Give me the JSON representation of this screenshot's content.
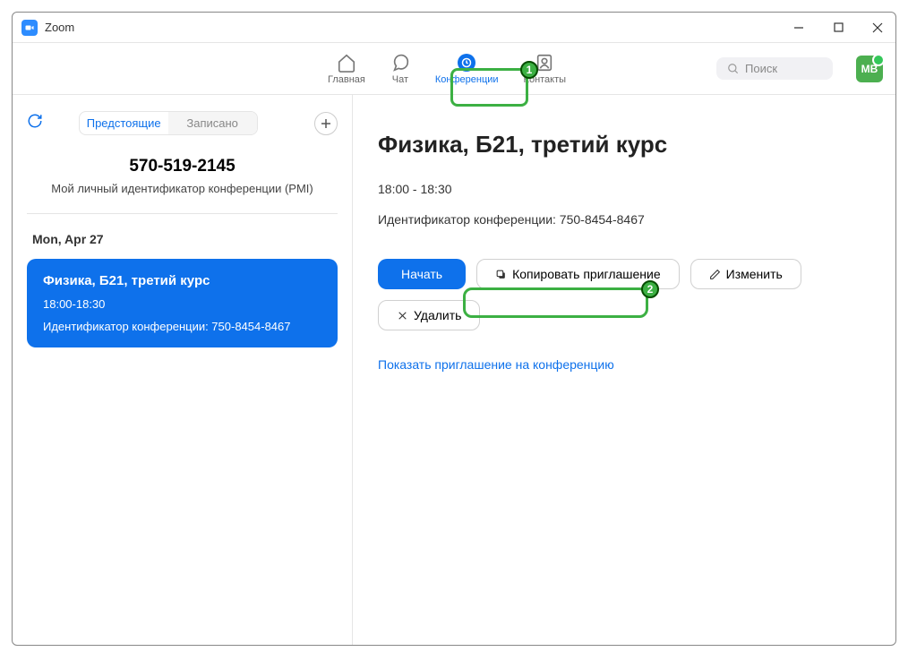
{
  "window": {
    "title": "Zoom"
  },
  "nav": {
    "home": "Главная",
    "chat": "Чат",
    "meetings": "Конференции",
    "contacts": "Контакты"
  },
  "search": {
    "placeholder": "Поиск"
  },
  "avatar": {
    "initials": "МВ"
  },
  "sidebar": {
    "tab_upcoming": "Предстоящие",
    "tab_recorded": "Записано",
    "pmi_number": "570-519-2145",
    "pmi_label": "Мой личный идентификатор конференции (PMI)",
    "date": "Mon, Apr 27",
    "meeting": {
      "title": "Физика, Б21, третий курс",
      "time": "18:00-18:30",
      "id_line": "Идентификатор конференции: 750-8454-8467"
    }
  },
  "main": {
    "title": "Физика, Б21, третий курс",
    "time": "18:00 - 18:30",
    "id_line": "Идентификатор конференции: 750-8454-8467",
    "btn_start": "Начать",
    "btn_copy": "Копировать приглашение",
    "btn_edit": "Изменить",
    "btn_delete": "Удалить",
    "show_invite": "Показать приглашение на конференцию"
  },
  "annotations": {
    "badge1": "1",
    "badge2": "2"
  }
}
